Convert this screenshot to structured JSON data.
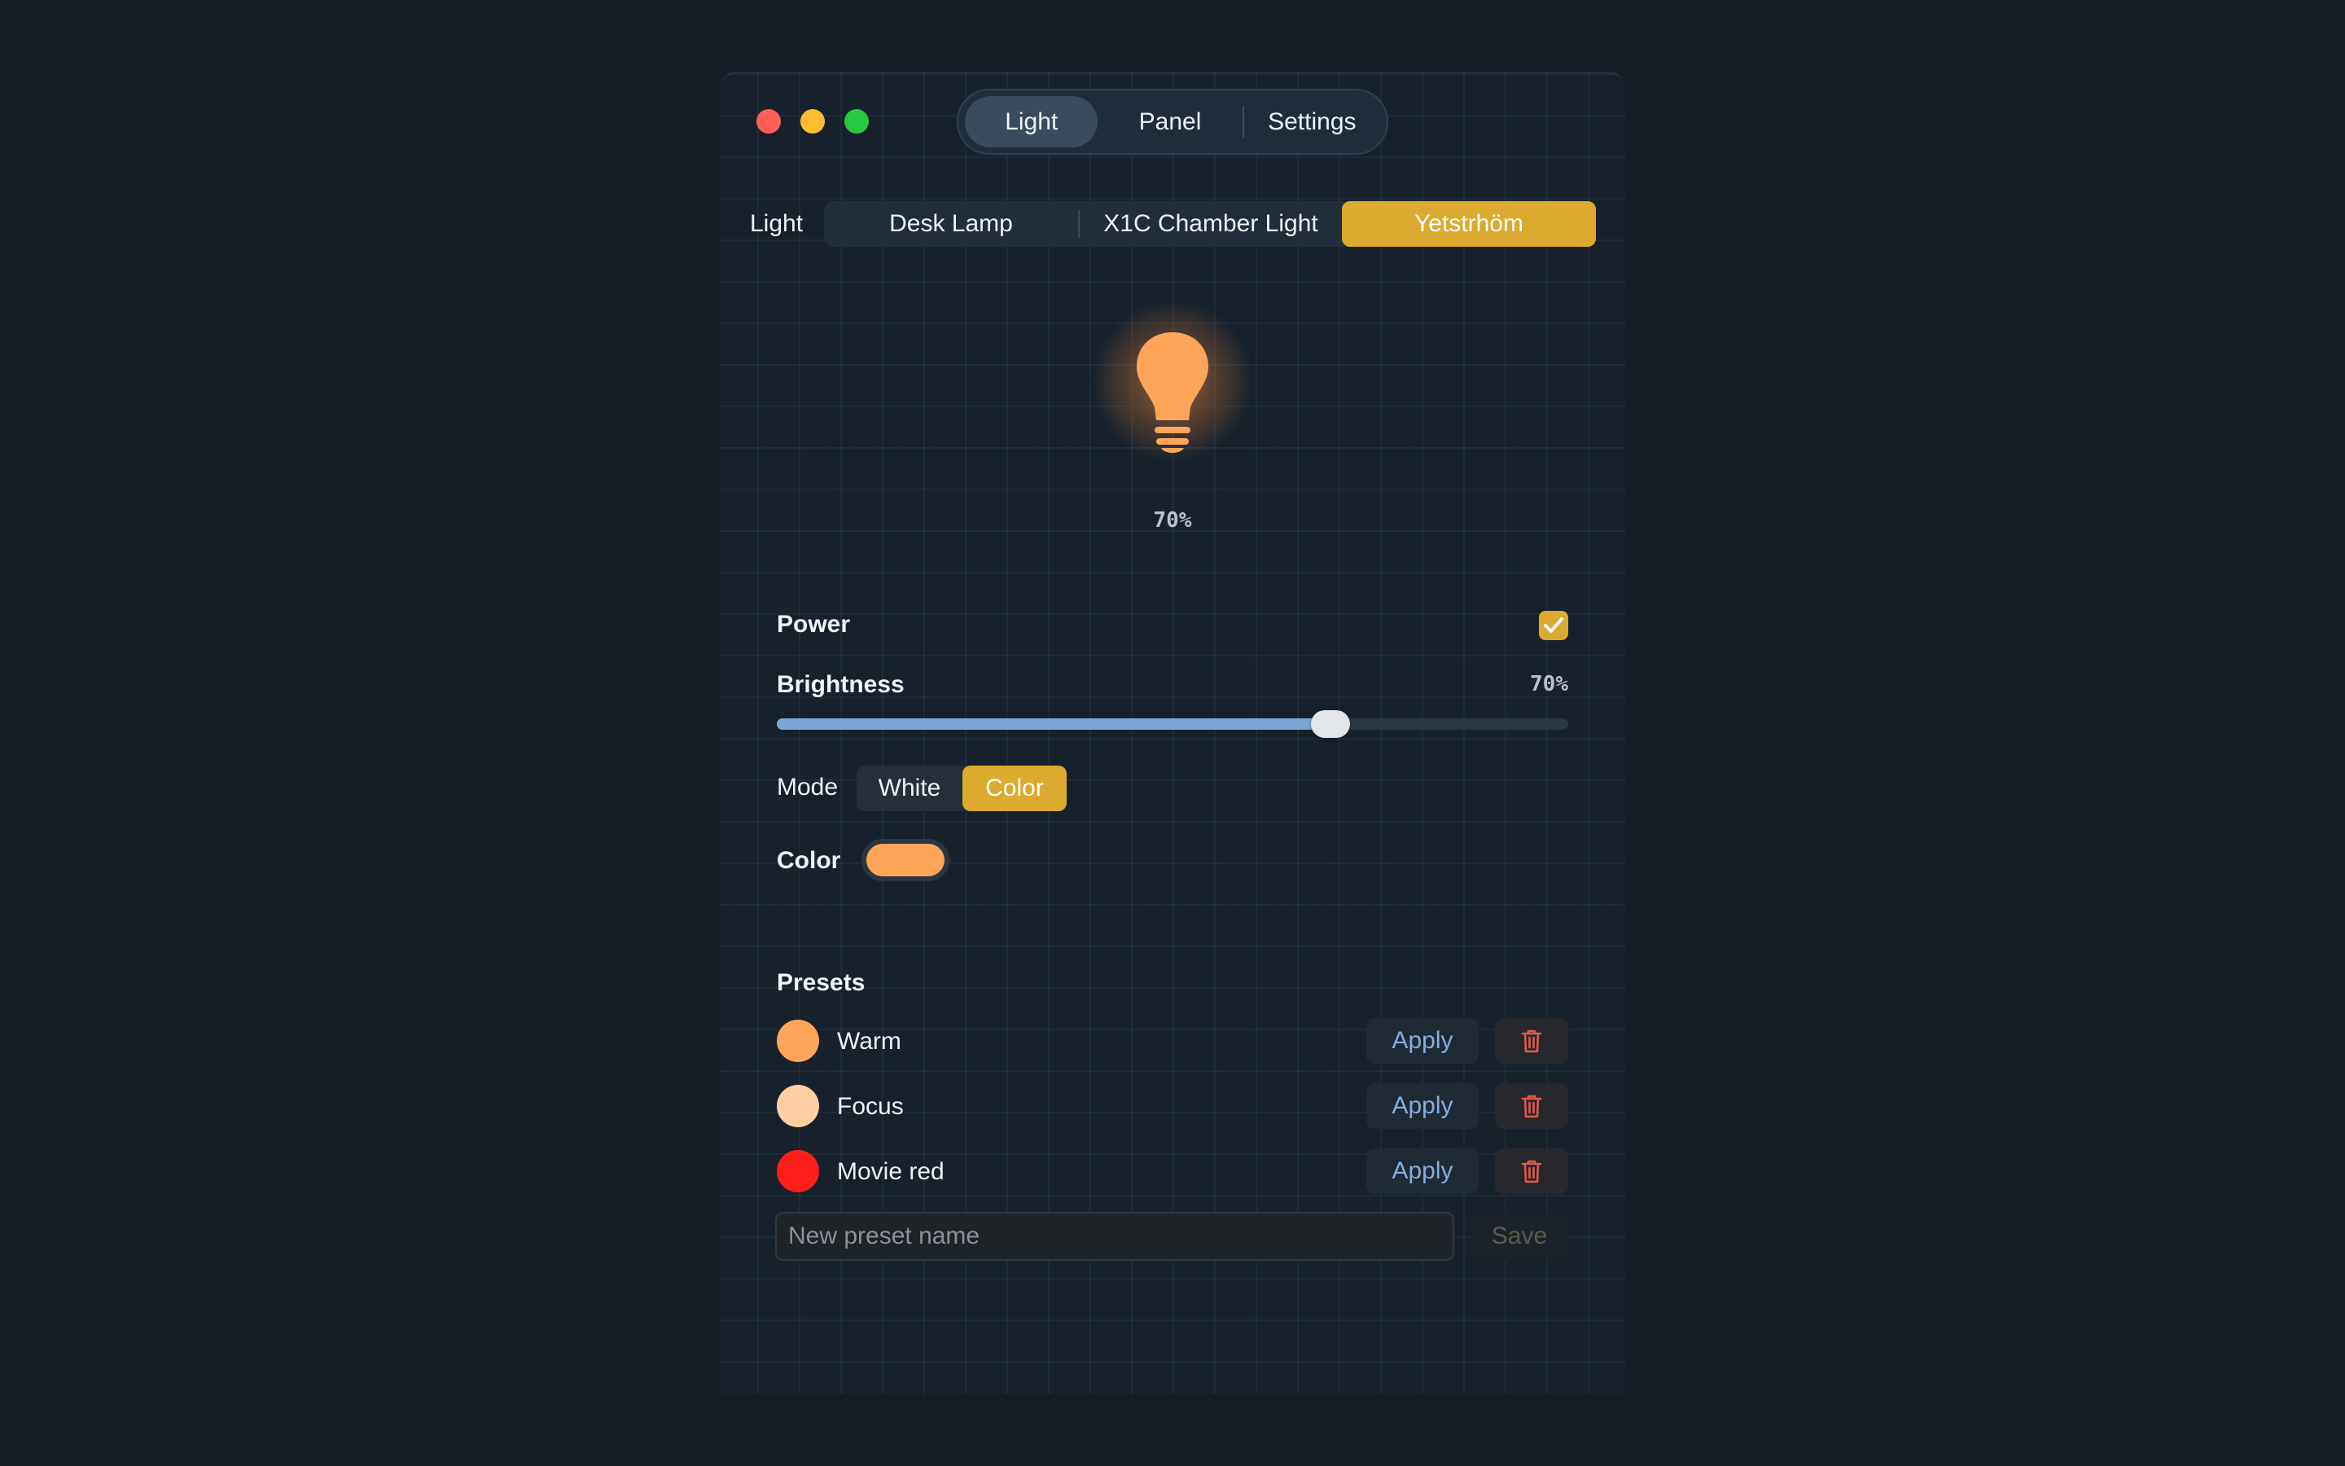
{
  "window": {
    "tabs": [
      {
        "label": "Light",
        "active": true
      },
      {
        "label": "Panel",
        "active": false
      },
      {
        "label": "Settings",
        "active": false
      }
    ]
  },
  "light": {
    "label": "Light",
    "devices": [
      {
        "label": "Desk Lamp",
        "active": false
      },
      {
        "label": "X1C Chamber Light",
        "active": false
      },
      {
        "label": "Yetstrhöm",
        "active": true
      }
    ],
    "bulb_percent": "70%",
    "bulb_color": "#ffa559"
  },
  "controls": {
    "power_label": "Power",
    "power_on": true,
    "brightness_label": "Brightness",
    "brightness_value": "70%",
    "brightness_fraction": 0.7,
    "mode_label": "Mode",
    "mode_options": [
      "White",
      "Color"
    ],
    "mode_selected": "Color",
    "color_label": "Color",
    "color_value": "#ffa559"
  },
  "presets": {
    "title": "Presets",
    "items": [
      {
        "name": "Warm",
        "color": "#ffa559",
        "apply_label": "Apply"
      },
      {
        "name": "Focus",
        "color": "#ffcfa3",
        "apply_label": "Apply"
      },
      {
        "name": "Movie red",
        "color": "#ff1f1a",
        "apply_label": "Apply"
      }
    ],
    "new_placeholder": "New preset name",
    "save_label": "Save"
  },
  "colors": {
    "accent": "#dbaa2e",
    "delete": "#e25a48",
    "link": "#84aedc"
  }
}
